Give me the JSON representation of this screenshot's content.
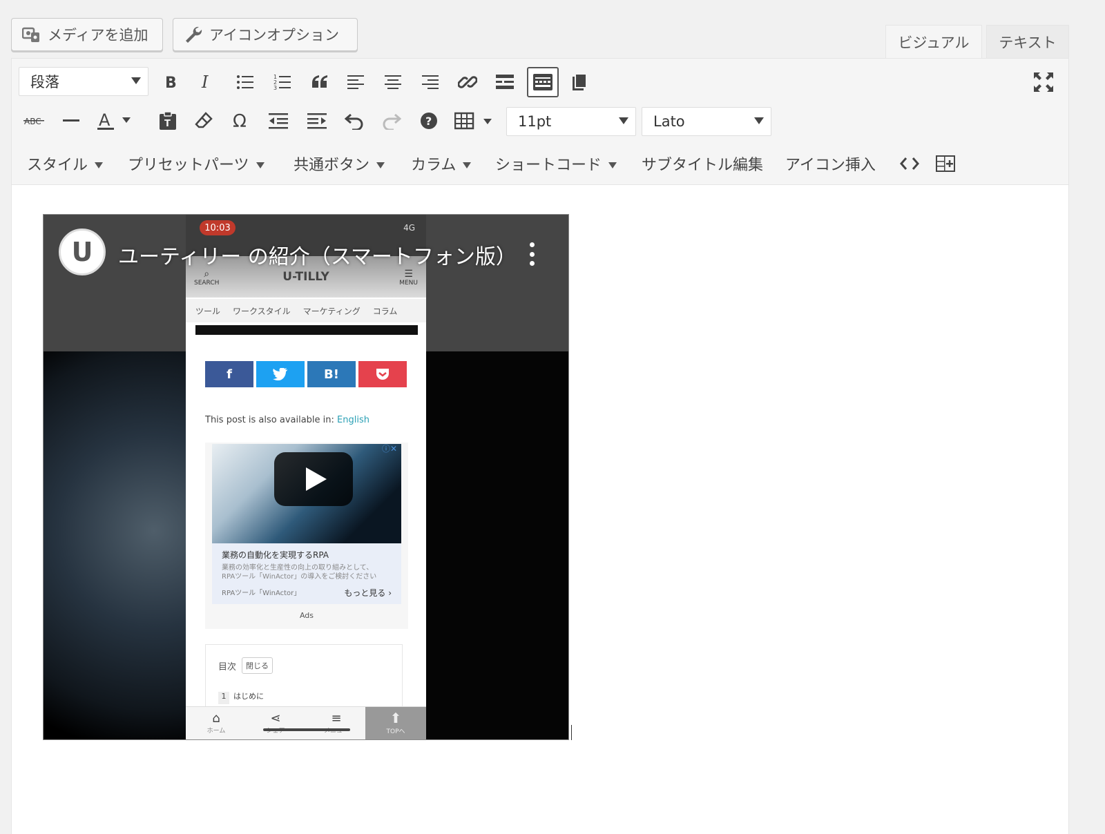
{
  "top_buttons": {
    "add_media": "メディアを追加",
    "icon_options": "アイコンオプション"
  },
  "mode_tabs": {
    "visual": "ビジュアル",
    "text": "テキスト"
  },
  "toolbar": {
    "format_select": "段落",
    "font_size_select": "11pt",
    "font_family_select": "Lato",
    "menus": {
      "style": "スタイル",
      "preset_parts": "プリセットパーツ",
      "common_button": "共通ボタン",
      "column": "カラム",
      "shortcode": "ショートコード",
      "subtitle_edit": "サブタイトル編集",
      "insert_icon": "アイコン挿入"
    },
    "icons": [
      "bold-icon",
      "italic-icon",
      "bullet-list-icon",
      "numbered-list-icon",
      "blockquote-icon",
      "align-left-icon",
      "align-center-icon",
      "align-right-icon",
      "link-icon",
      "read-more-icon",
      "toolbar-toggle-icon",
      "copy-icon",
      "fullscreen-icon",
      "strikethrough-icon",
      "horizontal-line-icon",
      "text-color-icon",
      "paste-text-icon",
      "clear-format-icon",
      "special-char-icon",
      "outdent-icon",
      "indent-icon",
      "undo-icon",
      "redo-icon",
      "help-icon",
      "table-icon",
      "code-icon",
      "add-table-icon"
    ]
  },
  "video": {
    "title": "ユーティリー の紹介（スマートフォン版）",
    "channel_initial": "U",
    "phone": {
      "time": "10:03",
      "signal": "4G",
      "logo": "U-TILLY",
      "search_label": "SEARCH",
      "menu_label": "MENU",
      "categories": [
        "ツール",
        "ワークスタイル",
        "マーケティング",
        "コラム"
      ],
      "share": {
        "facebook": "f",
        "twitter": "t",
        "hatena": "B!",
        "pocket": "P"
      },
      "available_prefix": "This post is also available in:",
      "available_link": "English",
      "ad": {
        "title": "業務の自動化を実現するRPA",
        "desc_1": "業務の効率化と生産性の向上の取り組みとして、",
        "desc_2": "RPAツール「WinActor」の導入をご検討ください",
        "source": "RPAツール「WinActor」",
        "more": "もっと見る",
        "label": "Ads"
      },
      "toc": {
        "title": "目次",
        "close": "閉じる",
        "item_num": "1",
        "item": "はじめに"
      },
      "nav": {
        "home": "ホーム",
        "share": "シェア",
        "menu": "メニュー",
        "top": "TOPへ"
      }
    }
  },
  "colors": {
    "facebook": "#3b5998",
    "twitter": "#1da1f2",
    "hatena": "#2c78b8",
    "pocket": "#e5424d",
    "link": "#2ba0b5"
  }
}
